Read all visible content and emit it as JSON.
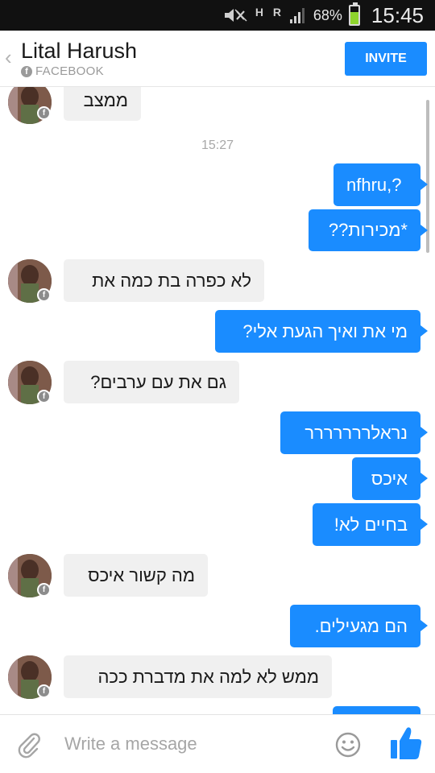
{
  "status_bar": {
    "battery_pct": "68%",
    "battery_level": 0.68,
    "time": "15:45",
    "icons": [
      "muted-icon",
      "data-h-icon",
      "data-r-icon",
      "signal-icon",
      "battery-icon"
    ],
    "network_h": "H",
    "network_r": "R"
  },
  "header": {
    "back_icon": "chevron-left-icon",
    "contact_name": "Lital Harush",
    "source": "FACEBOOK",
    "invite_label": "INVITE"
  },
  "colors": {
    "accent": "#1a8cff",
    "incoming_bubble": "#f0f0f0",
    "status_bar_bg": "#111111"
  },
  "conversation": {
    "timestamp": "15:27",
    "messages": [
      {
        "direction": "in",
        "text": "ממצב"
      },
      {
        "direction": "out",
        "text": "nfhru,?"
      },
      {
        "direction": "out",
        "text": "*מכירות??"
      },
      {
        "direction": "in",
        "text": "לא כפרה בת כמה את"
      },
      {
        "direction": "out",
        "text": "מי את ואיך הגעת אלי?"
      },
      {
        "direction": "in",
        "text": "גם את עם ערבים?"
      },
      {
        "direction": "out",
        "text": "נראלררררררר"
      },
      {
        "direction": "out",
        "text": "איכס"
      },
      {
        "direction": "out",
        "text": "בחיים לא!"
      },
      {
        "direction": "in",
        "text": "מה קשור איכס"
      },
      {
        "direction": "out",
        "text": "הם מגעילים."
      },
      {
        "direction": "in",
        "text": "ממש לא למה את מדברת ככה"
      }
    ]
  },
  "composer": {
    "placeholder": "Write a message",
    "attach_icon": "paperclip-icon",
    "emoji_icon": "smiley-icon",
    "like_icon": "thumbs-up-icon"
  }
}
